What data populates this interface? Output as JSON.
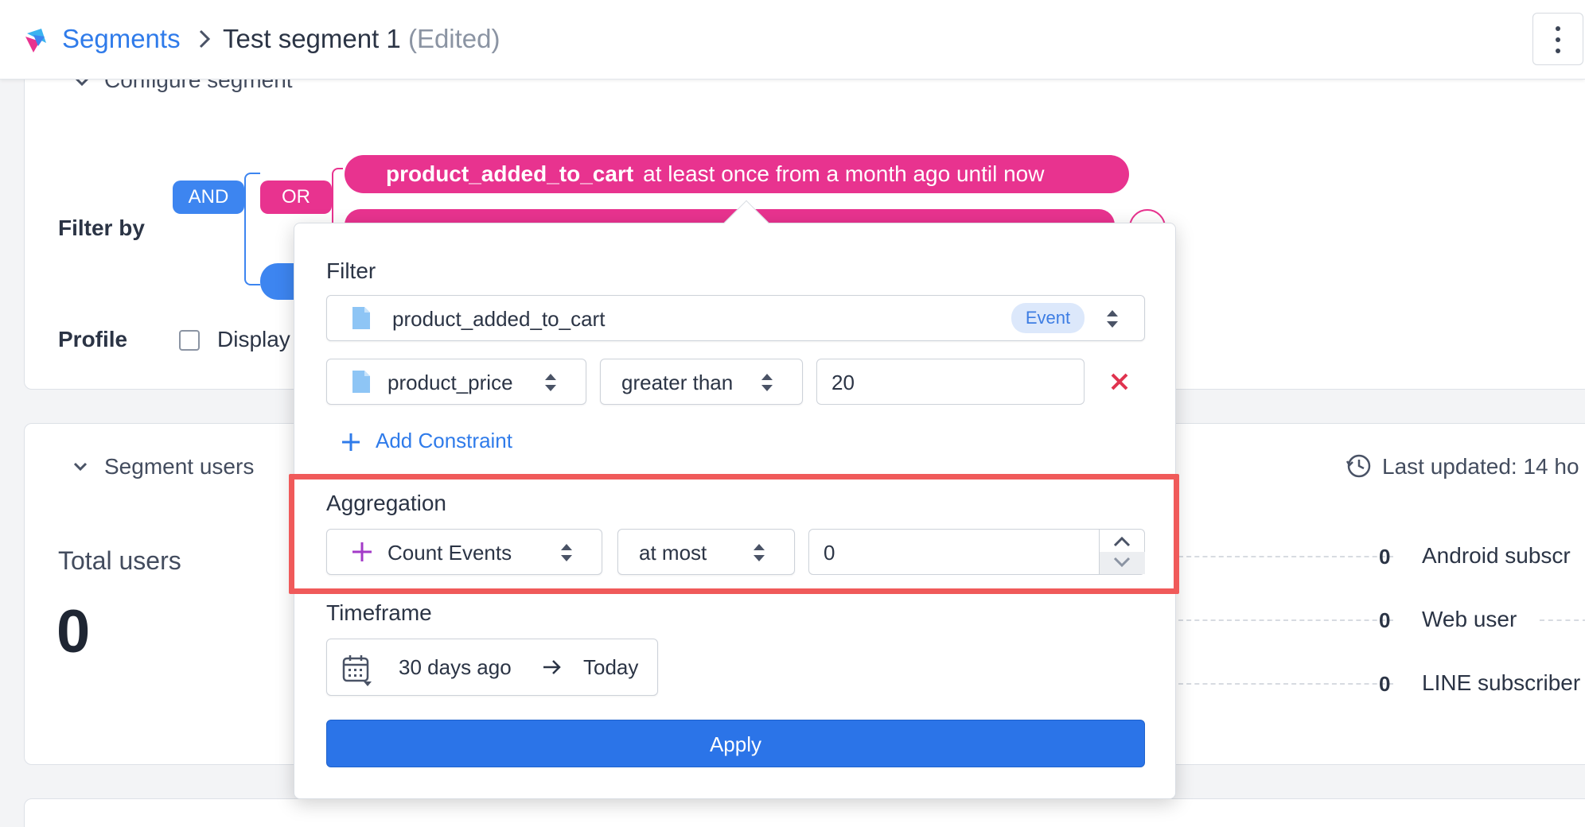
{
  "header": {
    "breadcrumb_root": "Segments",
    "page_title": "Test segment 1",
    "edited_label": "(Edited)"
  },
  "configure": {
    "title": "Configure segment",
    "filter_by_label": "Filter by",
    "and_label": "AND",
    "or_label": "OR",
    "chip1_event": "product_added_to_cart",
    "chip1_desc": "at least once from a month ago until now",
    "profile_label": "Profile",
    "display_label": "Display"
  },
  "segment_users": {
    "title": "Segment users",
    "last_updated": "Last updated: 14 ho",
    "total_label": "Total users",
    "total_value": "0",
    "rows": [
      {
        "count": "0",
        "label": "Android subscr"
      },
      {
        "count": "0",
        "label": "Web user"
      },
      {
        "count": "0",
        "label": "LINE subscriber"
      }
    ]
  },
  "popover": {
    "filter_label": "Filter",
    "event_name": "product_added_to_cart",
    "event_badge": "Event",
    "property": "product_price",
    "operator": "greater than",
    "value": "20",
    "add_constraint": "Add Constraint",
    "aggregation_label": "Aggregation",
    "aggregation_function": "Count Events",
    "aggregation_operator": "at most",
    "aggregation_value": "0",
    "timeframe_label": "Timeframe",
    "timeframe_start": "30 days ago",
    "timeframe_end": "Today",
    "apply_label": "Apply"
  },
  "colors": {
    "accent": "#2f7bea",
    "pink": "#e8338f",
    "highlight": "#f05a5a",
    "remove": "#e0334f"
  }
}
